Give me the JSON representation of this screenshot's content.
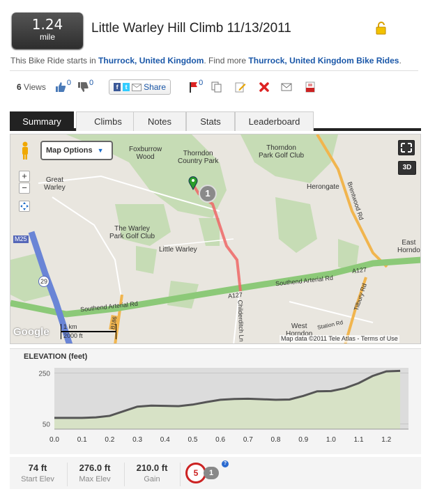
{
  "header": {
    "distance_value": "1.24",
    "distance_unit": "mile",
    "title": "Little Warley Hill Climb 11/13/2011"
  },
  "location": {
    "prefix": "This Bike Ride starts in ",
    "place": "Thurrock, United Kingdom",
    "middle": ". Find more ",
    "more_link": "Thurrock, United Kingdom Bike Rides",
    "suffix": "."
  },
  "actions": {
    "views_count": "6",
    "views_label": "Views",
    "thumbs_up_count": "0",
    "thumbs_down_count": "0",
    "share_label": "Share",
    "flag_count": "0"
  },
  "tabs": [
    "Summary",
    "Climbs",
    "Notes",
    "Stats",
    "Leaderboard"
  ],
  "map": {
    "options_label": "Map Options",
    "labels": {
      "foxburrow": "Foxburrow\nWood",
      "thorndon_country": "Thorndon\nCountry Park",
      "thorndon_golf": "Thorndon\nPark Golf Club",
      "great_warley": "Great\nWarley",
      "herongate": "Herongate",
      "warley_golf": "The Warley\nPark Golf Club",
      "little_warley": "Little Warley",
      "east_horndon": "East\nHorndo",
      "southend_arterial_1": "Southend Arterial Rd",
      "southend_arterial_2": "Southend Arterial Rd",
      "a127_1": "A127",
      "a127_2": "A127",
      "brentwood_rd": "Brentwood Rd",
      "tilbury_rd": "Tilbury Rd",
      "childerditch": "Childerditch Ln",
      "west_horndon": "West\nHorndon",
      "station_rd": "Station Rd",
      "m25": "M25",
      "j29": "29",
      "b186": "B186",
      "scale_km": "1 km",
      "scale_ft": "2000 ft",
      "copyright": "Map data ©2011 Tele Atlas - Terms of Use",
      "google": "Google",
      "marker_number": "1",
      "btn_3d": "3D"
    }
  },
  "elevation": {
    "title": "ELEVATION (feet)",
    "chart_data": {
      "type": "area",
      "x": [
        0.0,
        0.05,
        0.1,
        0.15,
        0.2,
        0.25,
        0.3,
        0.35,
        0.4,
        0.45,
        0.5,
        0.55,
        0.6,
        0.65,
        0.7,
        0.75,
        0.8,
        0.85,
        0.9,
        0.95,
        1.0,
        1.05,
        1.1,
        1.15,
        1.2,
        1.25
      ],
      "values": [
        74,
        74,
        74,
        76,
        82,
        100,
        118,
        122,
        121,
        120,
        126,
        136,
        145,
        148,
        149,
        147,
        145,
        146,
        160,
        178,
        179,
        190,
        210,
        238,
        256,
        258
      ],
      "y_ticks": [
        "250",
        "50"
      ],
      "x_ticks": [
        "0.0",
        "0.1",
        "0.2",
        "0.3",
        "0.4",
        "0.5",
        "0.6",
        "0.7",
        "0.8",
        "0.9",
        "1.0",
        "1.1",
        "1.2"
      ],
      "xlim": [
        0,
        1.28
      ],
      "ylim": [
        30,
        270
      ],
      "line_color": "#555555",
      "fill_color": "#d7e2c6"
    }
  },
  "stats": {
    "start_elev_value": "74 ft",
    "start_elev_label": "Start Elev",
    "max_elev_value": "276.0 ft",
    "max_elev_label": "Max Elev",
    "gain_value": "210.0 ft",
    "gain_label": "Gain",
    "climb_cat_1": "5",
    "climb_cat_2": "1",
    "help": "?"
  }
}
